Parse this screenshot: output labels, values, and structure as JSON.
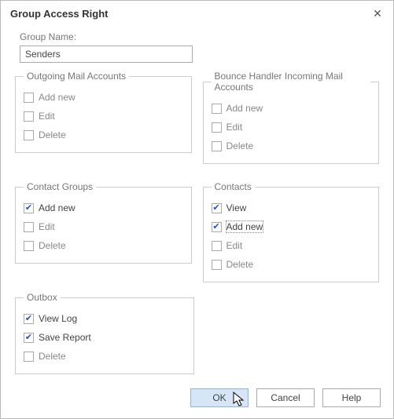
{
  "title": "Group Access Right",
  "groupNameLabel": "Group Name:",
  "groupNameValue": "Senders",
  "sections": {
    "outgoing": {
      "legend": "Outgoing Mail Accounts",
      "items": [
        {
          "label": "Add new",
          "checked": false
        },
        {
          "label": "Edit",
          "checked": false
        },
        {
          "label": "Delete",
          "checked": false
        }
      ]
    },
    "bounce": {
      "legend": "Bounce Handler Incoming Mail Accounts",
      "items": [
        {
          "label": "Add new",
          "checked": false
        },
        {
          "label": "Edit",
          "checked": false
        },
        {
          "label": "Delete",
          "checked": false
        }
      ]
    },
    "contactGroups": {
      "legend": "Contact Groups",
      "items": [
        {
          "label": "Add new",
          "checked": true
        },
        {
          "label": "Edit",
          "checked": false
        },
        {
          "label": "Delete",
          "checked": false
        }
      ]
    },
    "contacts": {
      "legend": "Contacts",
      "items": [
        {
          "label": "View",
          "checked": true
        },
        {
          "label": "Add new",
          "checked": true,
          "focused": true
        },
        {
          "label": "Edit",
          "checked": false
        },
        {
          "label": "Delete",
          "checked": false
        }
      ]
    },
    "outbox": {
      "legend": "Outbox",
      "items": [
        {
          "label": "View Log",
          "checked": true
        },
        {
          "label": "Save Report",
          "checked": true
        },
        {
          "label": "Delete",
          "checked": false
        }
      ]
    }
  },
  "buttons": {
    "ok": "OK",
    "cancel": "Cancel",
    "help": "Help"
  }
}
